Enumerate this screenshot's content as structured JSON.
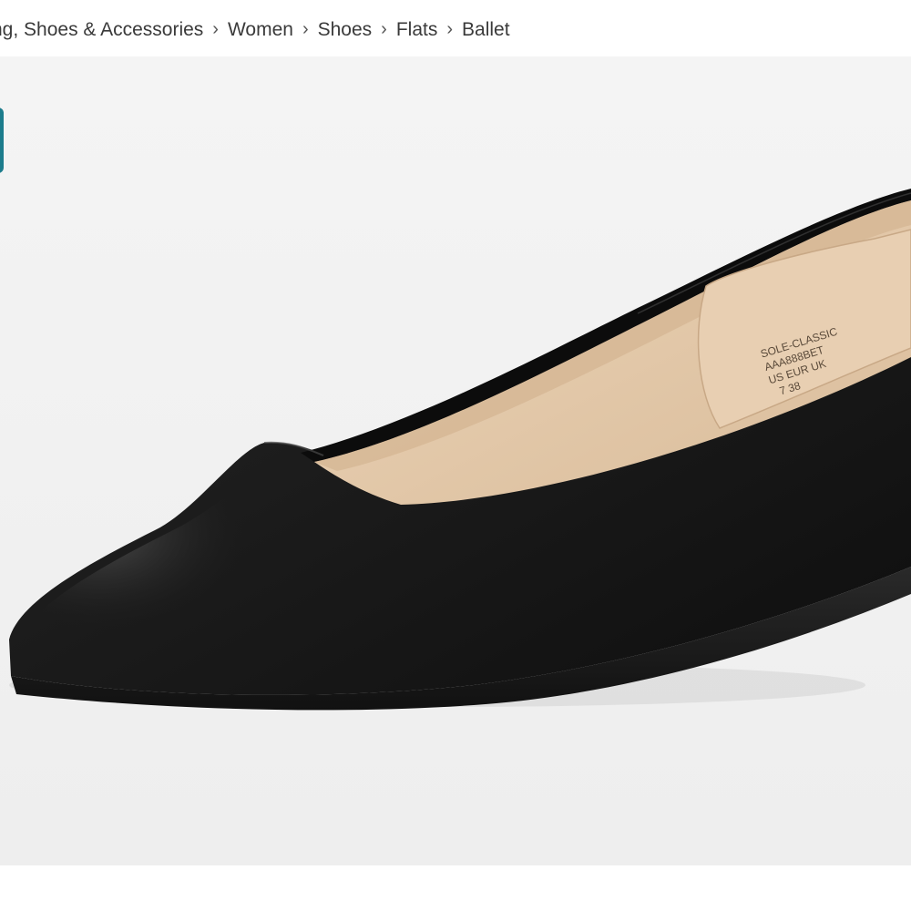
{
  "breadcrumb": {
    "items": [
      {
        "label": "ng, Shoes & Accessories"
      },
      {
        "label": "Women"
      },
      {
        "label": "Shoes"
      },
      {
        "label": "Flats"
      },
      {
        "label": "Ballet"
      }
    ],
    "separator": "›"
  },
  "product_image": {
    "insole_label": {
      "line1": "SOLE-CLASSIC",
      "line2": "AAA888BET",
      "line3": "US  EUR  UK",
      "line4": "7    38"
    }
  },
  "colors": {
    "accent": "#1c7c8c",
    "image_background": "#f2f2f2",
    "shoe": "#1a1a1a",
    "insole": "#e6ccaf"
  }
}
